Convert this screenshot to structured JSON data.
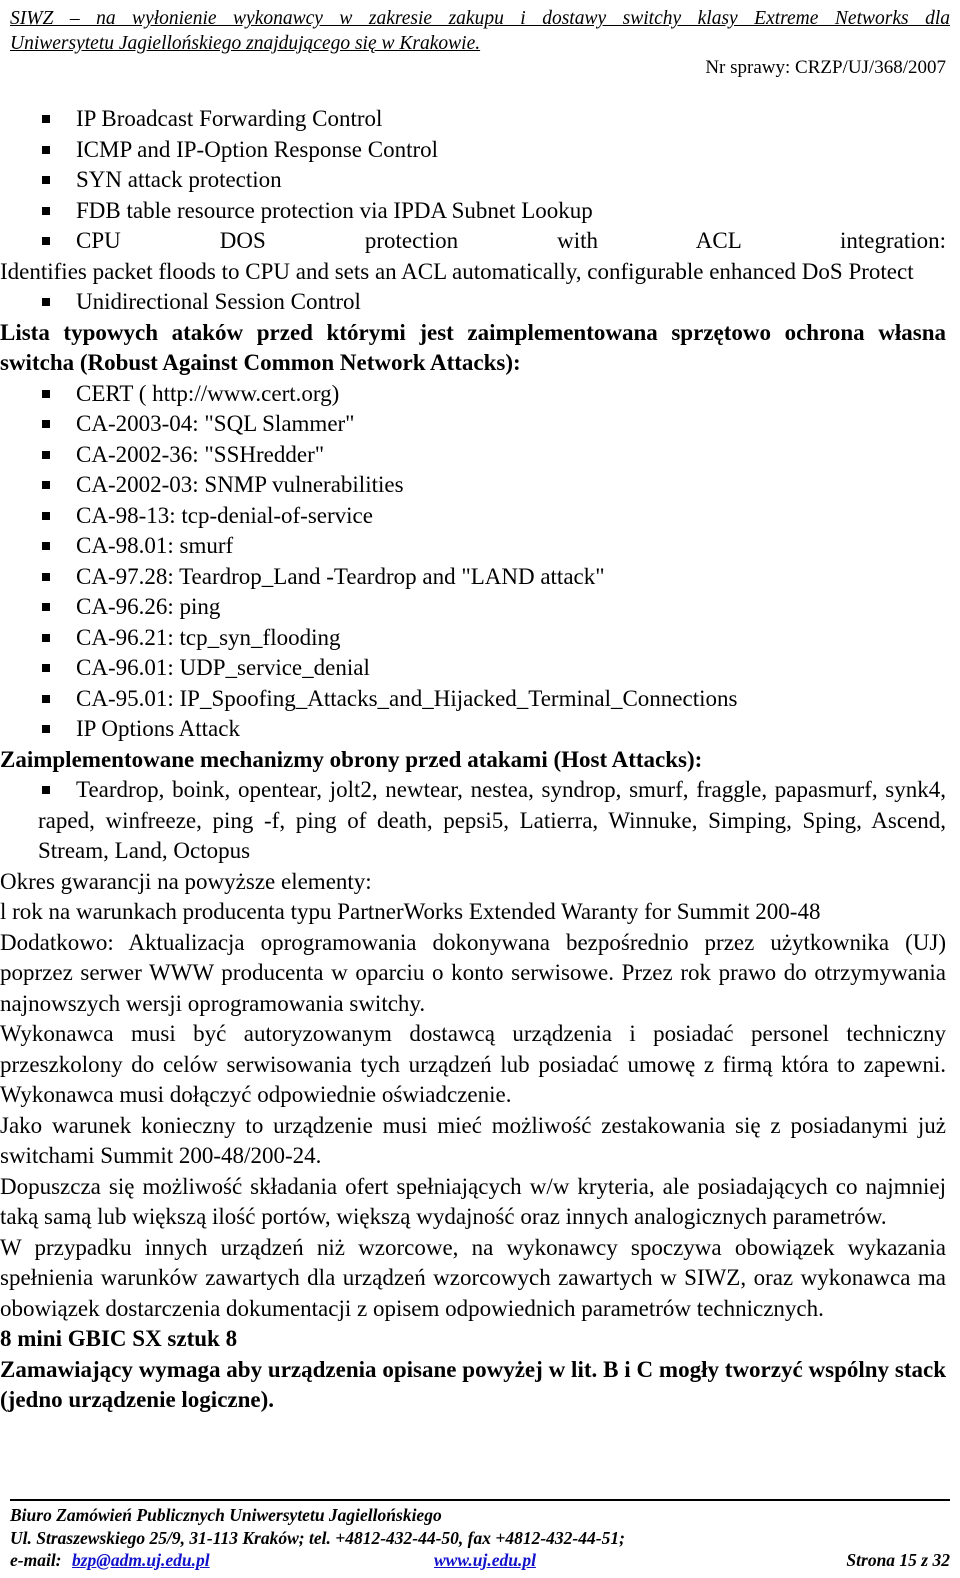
{
  "header": {
    "title_line1": "SIWZ – na wyłonienie wykonawcy w zakresie zakupu i dostawy switchy klasy Extreme Networks dla",
    "title_line2": "Uniwersytetu Jagiellońskiego znajdującego się w Krakowie.",
    "case_number": "Nr sprawy: CRZP/UJ/368/2007"
  },
  "body": {
    "feature_bullets": [
      "IP Broadcast Forwarding Control",
      "ICMP and IP-Option Response Control",
      "SYN attack protection",
      "FDB table resource protection via IPDA Subnet Lookup"
    ],
    "cpu_dos_line": "CPU DOS protection with ACL integration:",
    "cpu_dos_cont": "Identifies packet floods to CPU and sets an ACL automatically, configurable enhanced DoS Protect",
    "unidirectional_bullet": "Unidirectional Session Control",
    "heading_robust": "Lista typowych ataków przed którymi jest zaimplementowana sprzętowo ochrona własna switcha (Robust Against Common Network Attacks):",
    "cert_bullets": [
      "CERT ( http://www.cert.org)",
      "CA-2003-04: \"SQL Slammer\"",
      "CA-2002-36: \"SSHredder\"",
      "CA-2002-03: SNMP vulnerabilities",
      "CA-98-13: tcp-denial-of-service",
      "CA-98.01: smurf",
      "CA-97.28: Teardrop_Land -Teardrop and \"LAND attack\"",
      "CA-96.26: ping",
      "CA-96.21: tcp_syn_flooding",
      "CA-96.01: UDP_service_denial",
      "CA-95.01: IP_Spoofing_Attacks_and_Hijacked_Terminal_Connections",
      "IP Options Attack"
    ],
    "heading_host_attacks": "Zaimplementowane mechanizmy obrony przed atakami (Host Attacks):",
    "host_attacks_bullet": "Teardrop, boink, opentear, jolt2, newtear, nestea, syndrop, smurf, fraggle, papasmurf, synk4, raped, winfreeze, ping -f, ping of death, pepsi5, Latierra, Winnuke, Simping, Sping, Ascend, Stream, Land, Octopus",
    "warranty_label": "Okres gwarancji na powyższe elementy:",
    "warranty_text": "l rok na warunkach producenta typu PartnerWorks Extended Waranty for Summit 200-48",
    "paragraphs": [
      "Dodatkowo: Aktualizacja oprogramowania dokonywana bezpośrednio przez użytkownika (UJ) poprzez serwer WWW producenta w oparciu o konto serwisowe. Przez rok prawo do otrzymywania najnowszych wersji oprogramowania switchy.",
      "Wykonawca musi być autoryzowanym dostawcą urządzenia i posiadać personel techniczny przeszkolony do celów serwisowania tych urządzeń lub posiadać umowę z firmą która to zapewni. Wykonawca musi dołączyć odpowiednie oświadczenie.",
      "Jako warunek konieczny to urządzenie musi mieć możliwość zestakowania się z posiadanymi już switchami Summit 200-48/200-24.",
      "Dopuszcza się możliwość składania ofert spełniających w/w kryteria, ale posiadających co najmniej taką samą lub większą ilość portów, większą wydajność oraz innych analogicznych parametrów.",
      "W przypadku innych urządzeń niż wzorcowe, na wykonawcy spoczywa obowiązek wykazania spełnienia warunków zawartych dla urządzeń wzorcowych zawartych w SIWZ, oraz wykonawca ma obowiązek dostarczenia dokumentacji z opisem odpowiednich parametrów technicznych."
    ],
    "gbic_line": "8 mini GBIC SX sztuk 8",
    "stack_requirement": "Zamawiający wymaga aby urządzenia opisane powyżej w lit. B i C mogły tworzyć wspólny stack (jedno urządzenie logiczne)."
  },
  "footer": {
    "office": "Biuro Zamówień Publicznych Uniwersytetu Jagiellońskiego",
    "address": "Ul. Straszewskiego 25/9, 31-113 Kraków; tel. +4812-432-44-50, fax +4812-432-44-51;",
    "email_label": "e-mail:",
    "email": "bzp@adm.uj.edu.pl",
    "website": "www.uj.edu.pl",
    "page": "Strona 15 z 32"
  },
  "colors": {
    "link": "#1111cc",
    "text": "#000000",
    "background": "#ffffff"
  }
}
